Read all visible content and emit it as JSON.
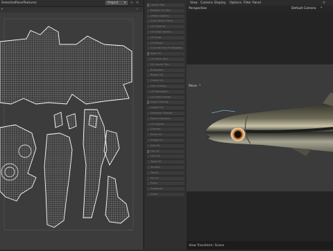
{
  "uv_editor": {
    "menu": [
      "Selection",
      "Panel",
      "Textures"
    ],
    "selector_value": "Project"
  },
  "tools": {
    "items": [
      "Layout Tool",
      "Relative Ctl Skin",
      "Unfold Options",
      "Auto Seams Panel",
      "UV Cleanup",
      "UV Shell Options",
      "UV Snap",
      "UV Planar",
      "Cut and Sew UV Mapping",
      "Align UV",
      "UV Stitch Tool",
      "UV Layout Tool",
      "Straighten",
      "Rotate UV",
      "Create UV",
      "Grid Overlay",
      "UV Navigation",
      "UV Shell Groups",
      "Edge Coloring",
      "Isolate UV",
      "Distortion Shader",
      "Texture Borders",
      "UV Display",
      "Checker",
      "Shells UV",
      "Image UV",
      "Sort UV",
      "Flip UV",
      "Grid UV",
      "Texel UV",
      "Smooth",
      "Tweak",
      "Pin UV",
      "Paste",
      "Snapshot",
      "Scale"
    ]
  },
  "viewport": {
    "menu": [
      "View",
      "Camera",
      "Display",
      "Options",
      "Filter",
      "Panel"
    ],
    "perspective_label": "Perspective",
    "camera_label": "Default Camera",
    "model_label": "Move",
    "status_text": "View Transform: Scene"
  },
  "colors": {
    "accent": "#e87722",
    "uv_wire": "#f0f0f0",
    "uv_bg": "#3c3c3c",
    "render_bg": "#3b3b3b"
  }
}
